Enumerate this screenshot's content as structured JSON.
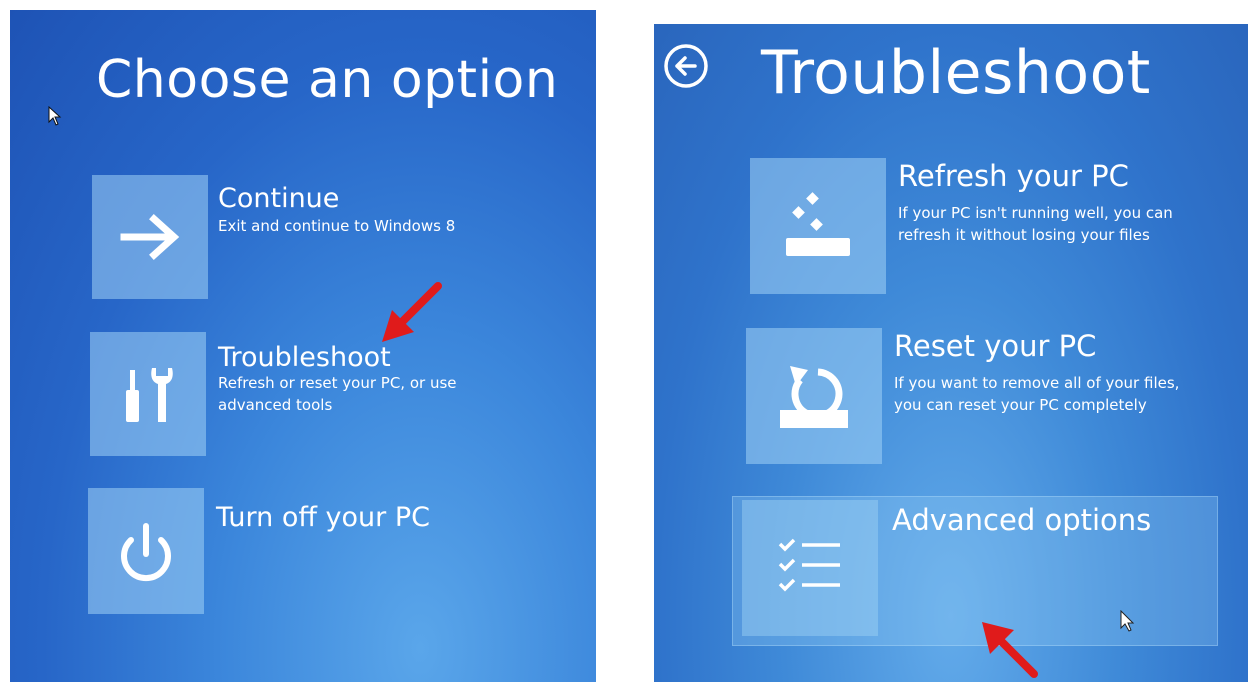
{
  "left_screen": {
    "title": "Choose an option",
    "options": [
      {
        "label": "Continue",
        "description": "Exit and continue to Windows 8",
        "icon": "arrow-right-icon"
      },
      {
        "label": "Troubleshoot",
        "description": "Refresh or reset your PC, or use advanced tools",
        "icon": "tools-icon"
      },
      {
        "label": "Turn off your PC",
        "description": "",
        "icon": "power-icon"
      }
    ]
  },
  "right_screen": {
    "title": "Troubleshoot",
    "back_icon": "back-arrow-icon",
    "options": [
      {
        "label": "Refresh your PC",
        "description": "If your PC isn't running well, you can refresh it without losing your files",
        "icon": "refresh-pc-icon"
      },
      {
        "label": "Reset your PC",
        "description": "If you want to remove all of your files, you can reset your PC completely",
        "icon": "reset-pc-icon"
      },
      {
        "label": "Advanced options",
        "description": "",
        "icon": "checklist-icon"
      }
    ]
  },
  "annotations": {
    "arrow_color": "#e01b1b",
    "left_arrow_target": "Troubleshoot",
    "right_arrow_target": "Advanced options"
  },
  "colors": {
    "background_blue": "#2a6cc8",
    "tile": "#8fc3ee",
    "text": "#ffffff"
  }
}
